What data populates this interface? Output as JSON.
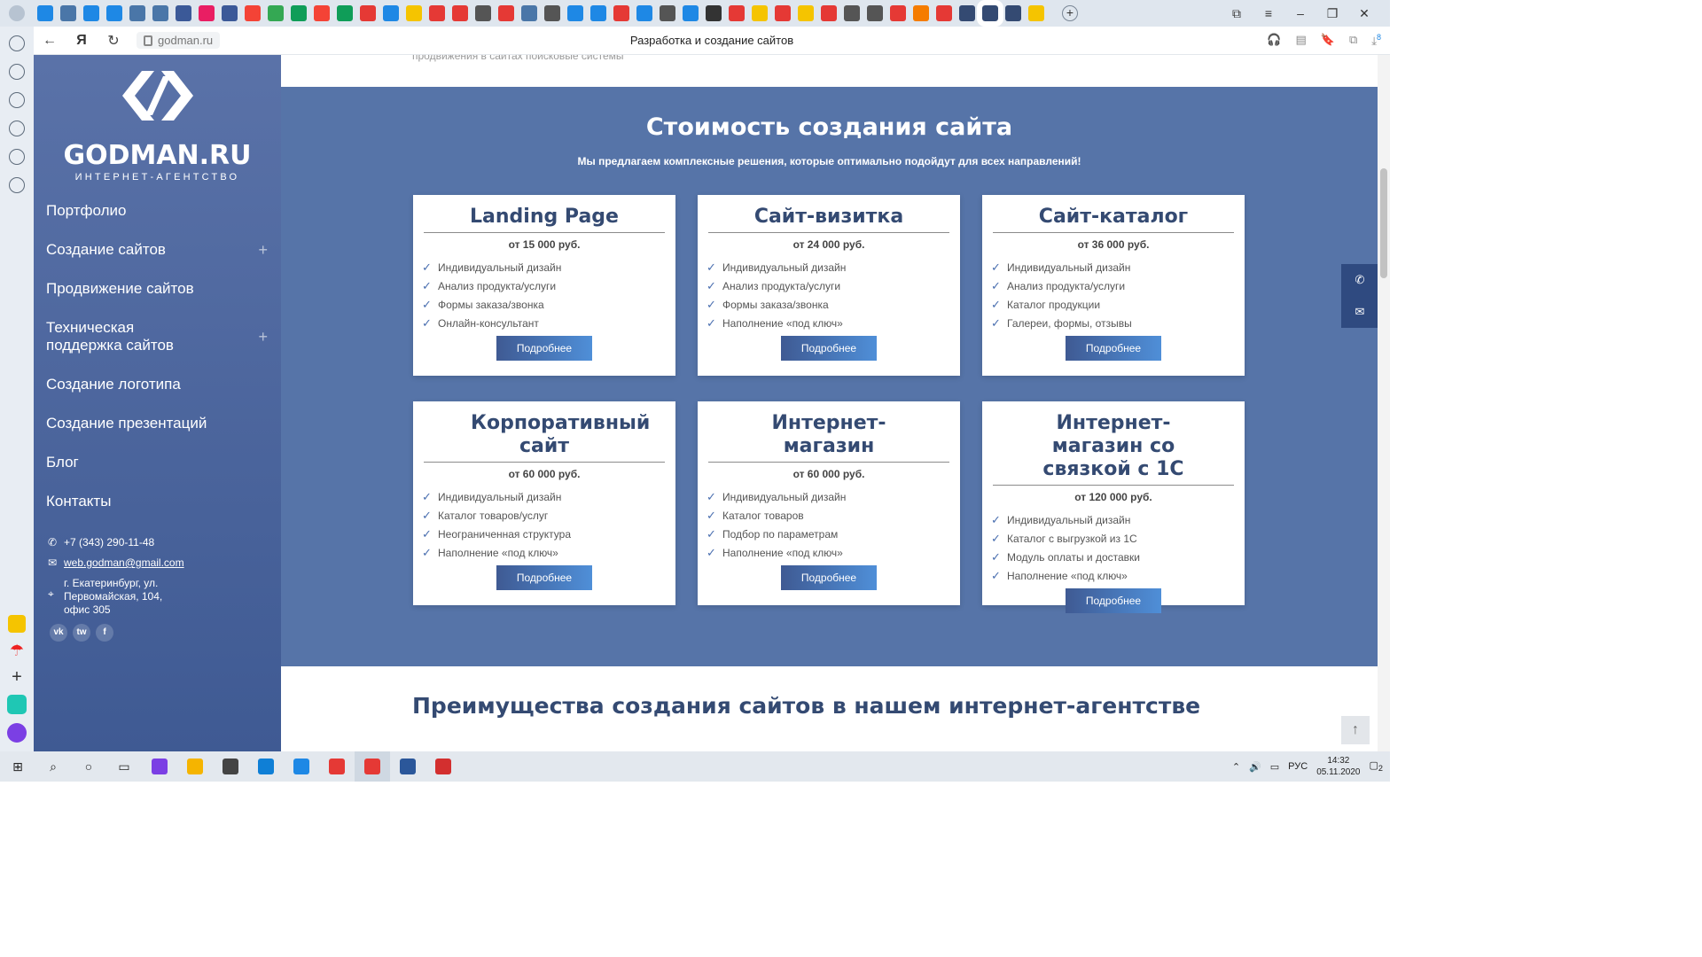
{
  "browser": {
    "tab_icon_colors": [
      "#1e88e5",
      "#4a76a8",
      "#1e88e5",
      "#1e88e5",
      "#4a76a8",
      "#4a76a8",
      "#3b5998",
      "#e91e63",
      "#3b5998",
      "#f44336",
      "#34a853",
      "#0f9d58",
      "#f44336",
      "#0f9d58",
      "#e53935",
      "#1e88e5",
      "#f5c400",
      "#e53935",
      "#e53935",
      "#555",
      "#e53935",
      "#4a76a8",
      "#555",
      "#1e88e5",
      "#1e88e5",
      "#e53935",
      "#1e88e5",
      "#555",
      "#1e88e5",
      "#333",
      "#e53935",
      "#f5c400",
      "#e53935",
      "#f5c400",
      "#e53935",
      "#555",
      "#555",
      "#e53935",
      "#f57c00",
      "#e53935",
      "#344a72",
      "#344a72",
      "#344a72",
      "#f5c400"
    ],
    "url": "godman.ru",
    "page_title": "Разработка и создание сайтов",
    "downloads_badge": "8"
  },
  "sidebar": {
    "brand": "GODMAN.RU",
    "brand_sub": "ИНТЕРНЕТ-АГЕНТСТВО",
    "menu": [
      {
        "label": "Портфолио"
      },
      {
        "label": "Создание сайтов",
        "expand": "+"
      },
      {
        "label": "Продвижение сайтов"
      },
      {
        "label": "Техническая поддержка сайтов",
        "expand": "+"
      },
      {
        "label": "Создание логотипа"
      },
      {
        "label": "Создание презентаций"
      },
      {
        "label": "Блог"
      },
      {
        "label": "Контакты"
      }
    ],
    "phone": "+7 (343) 290-11-48",
    "email": "web.godman@gmail.com",
    "address": "г. Екатеринбург, ул. Первомайская, 104, офис 305",
    "socials": [
      "vk",
      "tw",
      "f"
    ]
  },
  "main": {
    "cut_text": "продвижения в сайтах поисковые системы",
    "pricing_title": "Стоимость создания сайта",
    "pricing_sub": "Мы предлагаем комплексные решения, которые оптимально подойдут для всех направлений!",
    "cards": [
      {
        "title": "Landing Page",
        "price": "от 15 000 руб.",
        "features": [
          "Индивидуальный дизайн",
          "Анализ продукта/услуги",
          "Формы заказа/звонка",
          "Онлайн-консультант"
        ],
        "button": "Подробнее"
      },
      {
        "title": "Сайт-визитка",
        "price": "от 24 000 руб.",
        "features": [
          "Индивидуальный дизайн",
          "Анализ продукта/услуги",
          "Формы заказа/звонка",
          "Наполнение «под ключ»"
        ],
        "button": "Подробнее"
      },
      {
        "title": "Сайт-каталог",
        "price": "от 36 000 руб.",
        "features": [
          "Индивидуальный дизайн",
          "Анализ продукта/услуги",
          "Каталог продукции",
          "Галереи, формы, отзывы"
        ],
        "button": "Подробнее"
      },
      {
        "title": "Корпоративный сайт",
        "price": "от 60 000 руб.",
        "features": [
          "Индивидуальный дизайн",
          "Каталог товаров/услуг",
          "Неограниченная структура",
          "Наполнение «под ключ»"
        ],
        "button": "Подробнее"
      },
      {
        "title": "Интернет-магазин",
        "price": "от 60 000 руб.",
        "features": [
          "Индивидуальный дизайн",
          "Каталог товаров",
          "Подбор по параметрам",
          "Наполнение «под ключ»"
        ],
        "button": "Подробнее"
      },
      {
        "title": "Интернет-магазин со связкой с 1С",
        "price": "от 120 000 руб.",
        "features": [
          "Индивидуальный дизайн",
          "Каталог с выгрузкой из 1С",
          "Модуль оплаты и доставки",
          "Наполнение «под ключ»"
        ],
        "button": "Подробнее"
      }
    ],
    "advantages_title": "Преимущества создания сайтов в нашем интернет-агентстве"
  },
  "taskbar": {
    "lang": "РУС",
    "time": "14:32",
    "date": "05.11.2020",
    "notif_count": "2",
    "app_colors": [
      "#7b3fe4",
      "#f5b400",
      "#444",
      "#0f7fd6",
      "#1e88e5",
      "#e53935",
      "#e53935",
      "#2b579a",
      "#d32f2f"
    ]
  }
}
